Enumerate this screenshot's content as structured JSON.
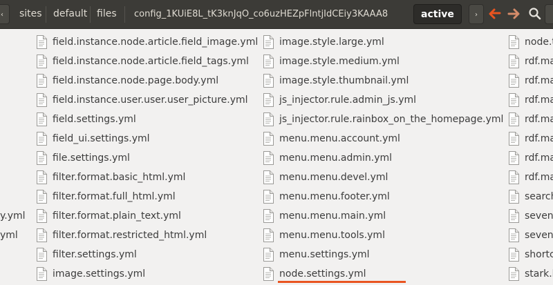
{
  "toolbar": {
    "back_arrow": "‹",
    "forward_arrow": "›",
    "breadcrumbs": [
      "sites",
      "default",
      "files",
      "config_1KUiE8L_tK3knJqO_co6uzHEZpFlntjIdCEiy3KAAA8"
    ],
    "active_crumb": "active",
    "icons": [
      "back-icon",
      "forward-icon",
      "search-icon"
    ],
    "accent": "#e95420"
  },
  "columns": [
    {
      "items": [
        "",
        "",
        "",
        "",
        "",
        "",
        "",
        "",
        "",
        "y.yml",
        "yml",
        "",
        ""
      ]
    },
    {
      "items": [
        "field.instance.node.article.field_image.yml",
        "field.instance.node.article.field_tags.yml",
        "field.instance.node.page.body.yml",
        "field.instance.user.user.user_picture.yml",
        "field.settings.yml",
        "field_ui.settings.yml",
        "file.settings.yml",
        "filter.format.basic_html.yml",
        "filter.format.full_html.yml",
        "filter.format.plain_text.yml",
        "filter.format.restricted_html.yml",
        "filter.settings.yml",
        "image.settings.yml"
      ]
    },
    {
      "items": [
        "image.style.large.yml",
        "image.style.medium.yml",
        "image.style.thumbnail.yml",
        "js_injector.rule.admin_js.yml",
        "js_injector.rule.rainbox_on_the_homepage.yml",
        "menu.menu.account.yml",
        "menu.menu.admin.yml",
        "menu.menu.devel.yml",
        "menu.menu.footer.yml",
        "menu.menu.main.yml",
        "menu.menu.tools.yml",
        "menu.settings.yml",
        "node.settings.yml"
      ]
    },
    {
      "items": [
        "node.t",
        "rdf.ma",
        "rdf.ma",
        "rdf.ma",
        "rdf.ma",
        "rdf.ma",
        "rdf.ma",
        "rdf.ma",
        "search",
        "seven.",
        "seven.",
        "shortc",
        "stark.bl"
      ]
    }
  ]
}
